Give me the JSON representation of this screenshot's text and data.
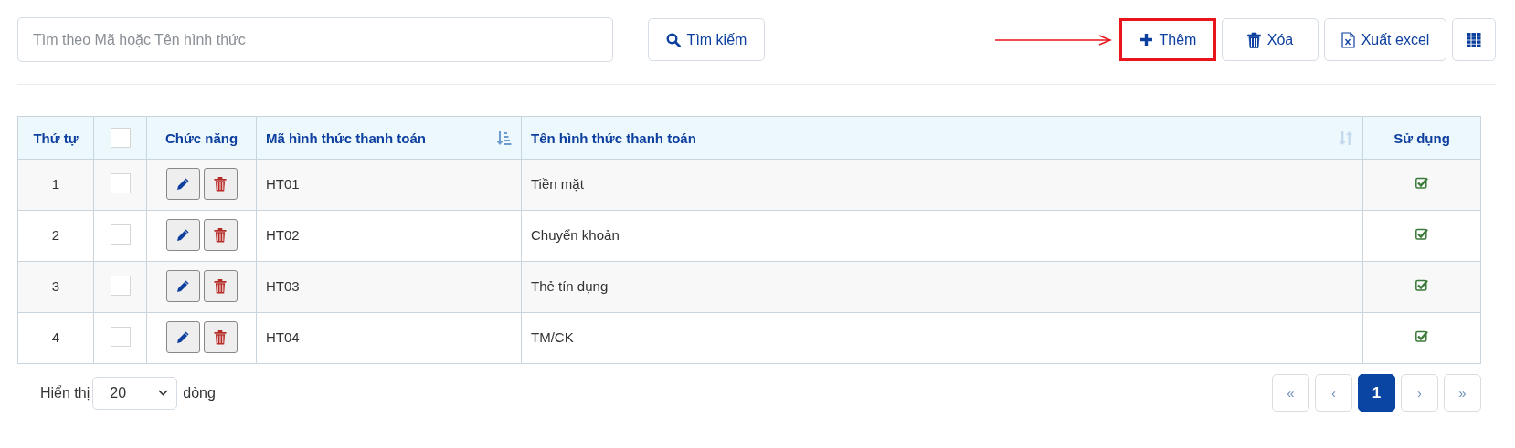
{
  "search": {
    "placeholder": "Tìm theo Mã hoặc Tên hình thức",
    "button": "Tìm kiếm"
  },
  "toolbar": [
    {
      "kind": "add",
      "label": "Thêm",
      "highlighted": true
    },
    {
      "kind": "delete",
      "label": "Xóa",
      "highlighted": false
    },
    {
      "kind": "export",
      "label": "Xuất excel",
      "highlighted": false
    },
    {
      "kind": "columns",
      "highlighted": false
    }
  ],
  "table": {
    "columns": [
      {
        "kind": "order",
        "label": "Thứ tự"
      },
      {
        "kind": "select",
        "checked": false
      },
      {
        "kind": "actions",
        "label": "Chức năng"
      },
      {
        "kind": "code",
        "label": "Mã hình thức thanh toán",
        "sort_active": true
      },
      {
        "kind": "name",
        "label": "Tên hình thức thanh toán",
        "sort_active": false
      },
      {
        "kind": "use",
        "label": "Sử dụng"
      }
    ],
    "rows": [
      {
        "order": "1",
        "checked": false,
        "code": "HT01",
        "name": "Tiền mặt",
        "in_use": true
      },
      {
        "order": "2",
        "checked": false,
        "code": "HT02",
        "name": "Chuyển khoản",
        "in_use": true
      },
      {
        "order": "3",
        "checked": false,
        "code": "HT03",
        "name": "Thẻ tín dụng",
        "in_use": true
      },
      {
        "order": "4",
        "checked": false,
        "code": "HT04",
        "name": "TM/CK",
        "in_use": true
      }
    ]
  },
  "footer": {
    "show_label": "Hiển thị",
    "page_size": "20",
    "rows_label": "dòng"
  },
  "pagination": [
    {
      "label": "«",
      "selected": false
    },
    {
      "label": "‹",
      "selected": false
    },
    {
      "label": "1",
      "selected": true
    },
    {
      "label": "›",
      "selected": false
    },
    {
      "label": "»",
      "selected": false
    }
  ]
}
